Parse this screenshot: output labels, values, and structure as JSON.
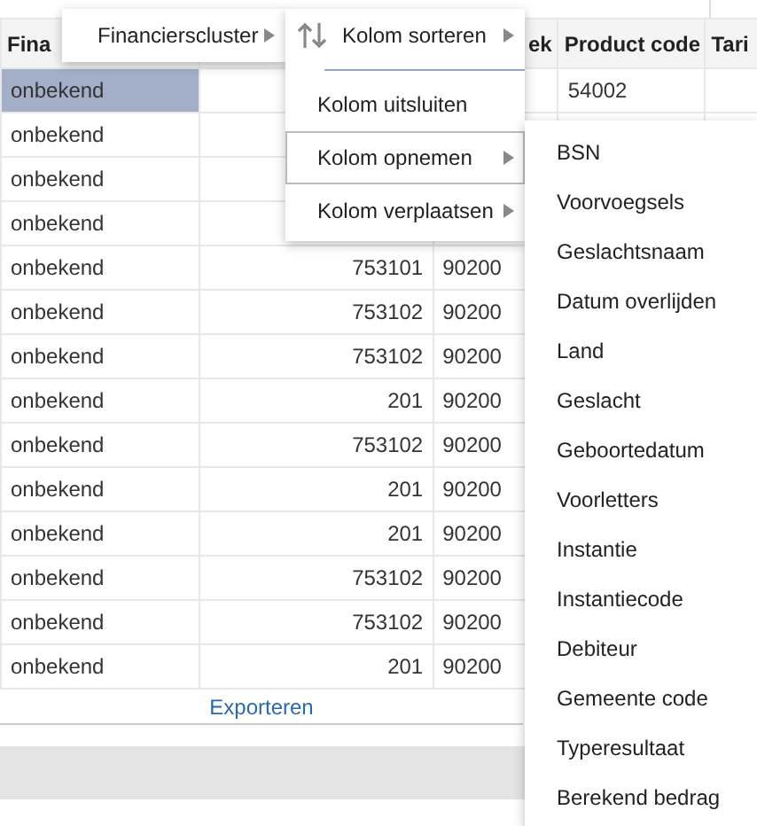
{
  "table": {
    "header": {
      "column_1": "Fina",
      "column_3": "ek",
      "column_4": "Product code",
      "column_5": "Tari"
    },
    "rows": [
      {
        "column_1": "onbekend",
        "column_4": "54002",
        "selected": true
      },
      {
        "column_1": "onbekend",
        "selected": false
      },
      {
        "column_1": "onbekend",
        "selected": false
      },
      {
        "column_1": "onbekend",
        "selected": false
      },
      {
        "column_1": "onbekend",
        "column_2": "753101",
        "column_3": "90200",
        "selected": false
      },
      {
        "column_1": "onbekend",
        "column_2": "753102",
        "column_3": "90200",
        "selected": false
      },
      {
        "column_1": "onbekend",
        "column_2": "753102",
        "column_3": "90200",
        "selected": false
      },
      {
        "column_1": "onbekend",
        "column_2": "201",
        "column_3": "90200",
        "selected": false
      },
      {
        "column_1": "onbekend",
        "column_2": "753102",
        "column_3": "90200",
        "selected": false
      },
      {
        "column_1": "onbekend",
        "column_2": "201",
        "column_3": "90200",
        "selected": false
      },
      {
        "column_1": "onbekend",
        "column_2": "201",
        "column_3": "90200",
        "selected": false
      },
      {
        "column_1": "onbekend",
        "column_2": "753102",
        "column_3": "90200",
        "selected": false
      },
      {
        "column_1": "onbekend",
        "column_2": "753102",
        "column_3": "90200",
        "selected": false
      },
      {
        "column_1": "onbekend",
        "column_2": "201",
        "column_3": "90200",
        "selected": false
      }
    ],
    "export_link": "Exporteren"
  },
  "column_menu": {
    "label": "Financierscluster",
    "has_submenu": true
  },
  "actions_menu": [
    {
      "label": "Kolom sorteren",
      "kind": "sort",
      "has_submenu": true,
      "highlighted": false
    },
    {
      "kind": "separator"
    },
    {
      "label": "Kolom uitsluiten",
      "kind": "item",
      "has_submenu": false,
      "highlighted": false
    },
    {
      "label": "Kolom opnemen",
      "kind": "item",
      "has_submenu": true,
      "highlighted": true
    },
    {
      "label": "Kolom verplaatsen",
      "kind": "item",
      "has_submenu": true,
      "highlighted": false
    }
  ],
  "include_menu": [
    "BSN",
    "Voorvoegsels",
    "Geslachtsnaam",
    "Datum overlijden",
    "Land",
    "Geslacht",
    "Geboortedatum",
    "Voorletters",
    "Instantie",
    "Instantiecode",
    "Debiteur",
    "Gemeente code",
    "Typeresultaat",
    "Berekend bedrag"
  ]
}
